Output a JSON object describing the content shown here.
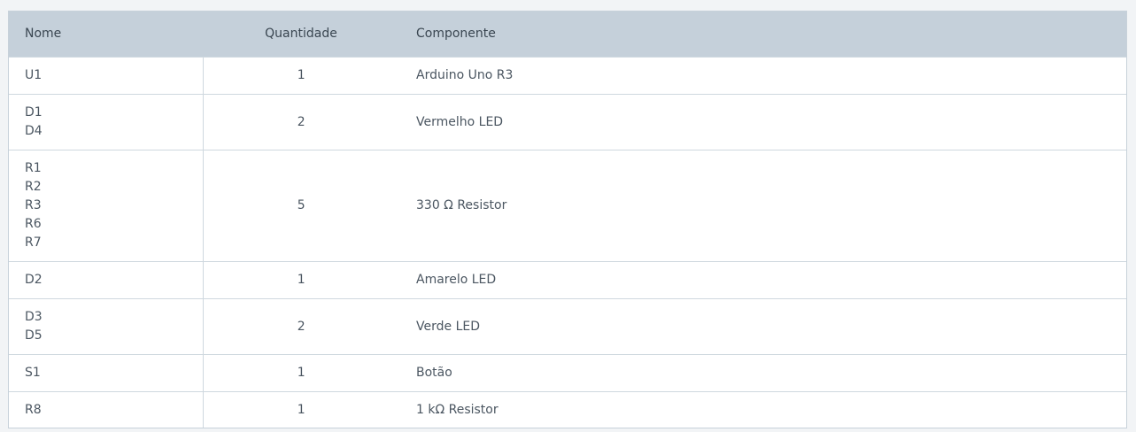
{
  "headers": {
    "nome": "Nome",
    "quantidade": "Quantidade",
    "componente": "Componente"
  },
  "rows": [
    {
      "nome": [
        "U1"
      ],
      "quantidade": "1",
      "componente": "Arduino Uno R3"
    },
    {
      "nome": [
        "D1",
        "D4"
      ],
      "quantidade": "2",
      "componente": "Vermelho LED"
    },
    {
      "nome": [
        "R1",
        "R2",
        "R3",
        "R6",
        "R7"
      ],
      "quantidade": "5",
      "componente": "330 Ω Resistor"
    },
    {
      "nome": [
        "D2"
      ],
      "quantidade": "1",
      "componente": "Amarelo LED"
    },
    {
      "nome": [
        "D3",
        "D5"
      ],
      "quantidade": "2",
      "componente": "Verde LED"
    },
    {
      "nome": [
        "S1"
      ],
      "quantidade": "1",
      "componente": "Botão"
    },
    {
      "nome": [
        "R8"
      ],
      "quantidade": "1",
      "componente": "1 kΩ Resistor"
    }
  ],
  "colors": {
    "header_bg": "#c5d0da",
    "page_bg": "#f2f4f6",
    "border": "#cfd8df",
    "text": "#4b5661"
  }
}
